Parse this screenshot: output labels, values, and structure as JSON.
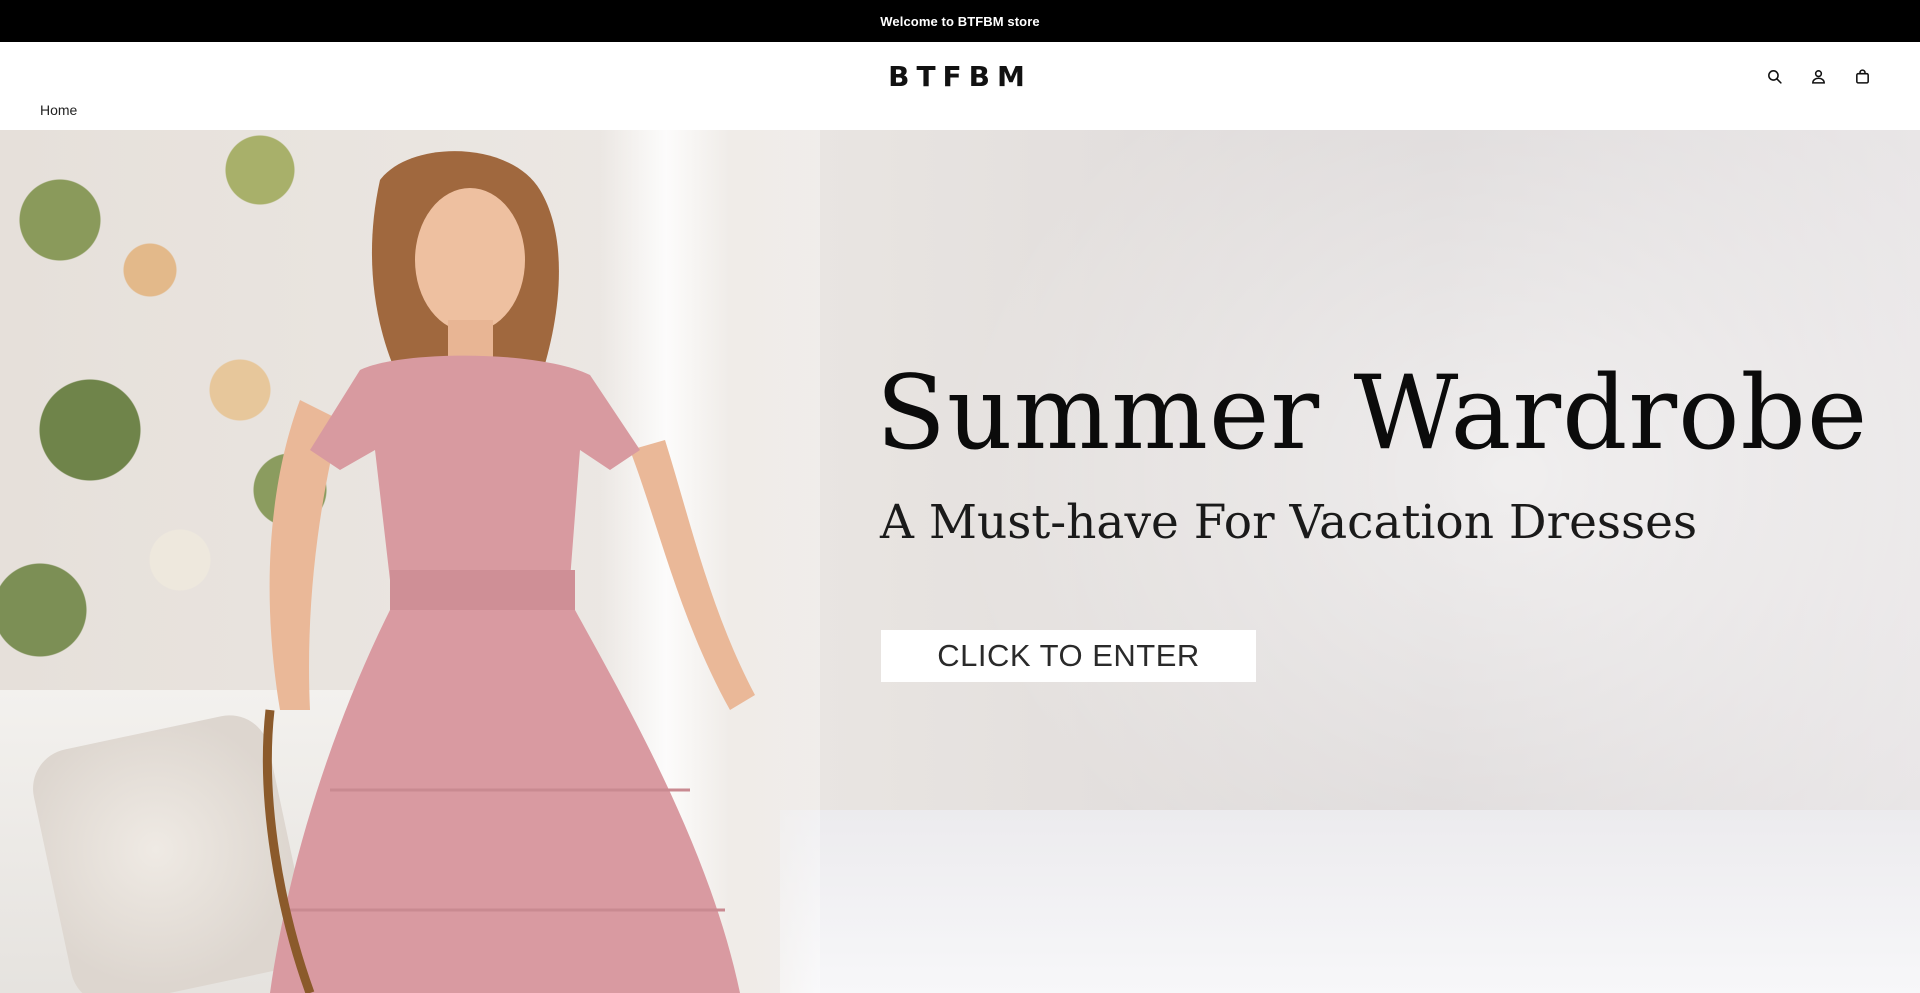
{
  "announcement": {
    "text": "Welcome to BTFBM store"
  },
  "header": {
    "logo": "BTFBM",
    "icons": [
      "search-icon",
      "account-icon",
      "cart-icon"
    ]
  },
  "breadcrumb": {
    "home": "Home"
  },
  "hero": {
    "headline": "Summer Wardrobe",
    "subheadline": "A Must-have For Vacation Dresses",
    "cta_label": "CLICK TO ENTER"
  },
  "colors": {
    "announcement_bg": "#000000",
    "dress": "#d89aa0",
    "cta_bg": "#ffffff"
  }
}
